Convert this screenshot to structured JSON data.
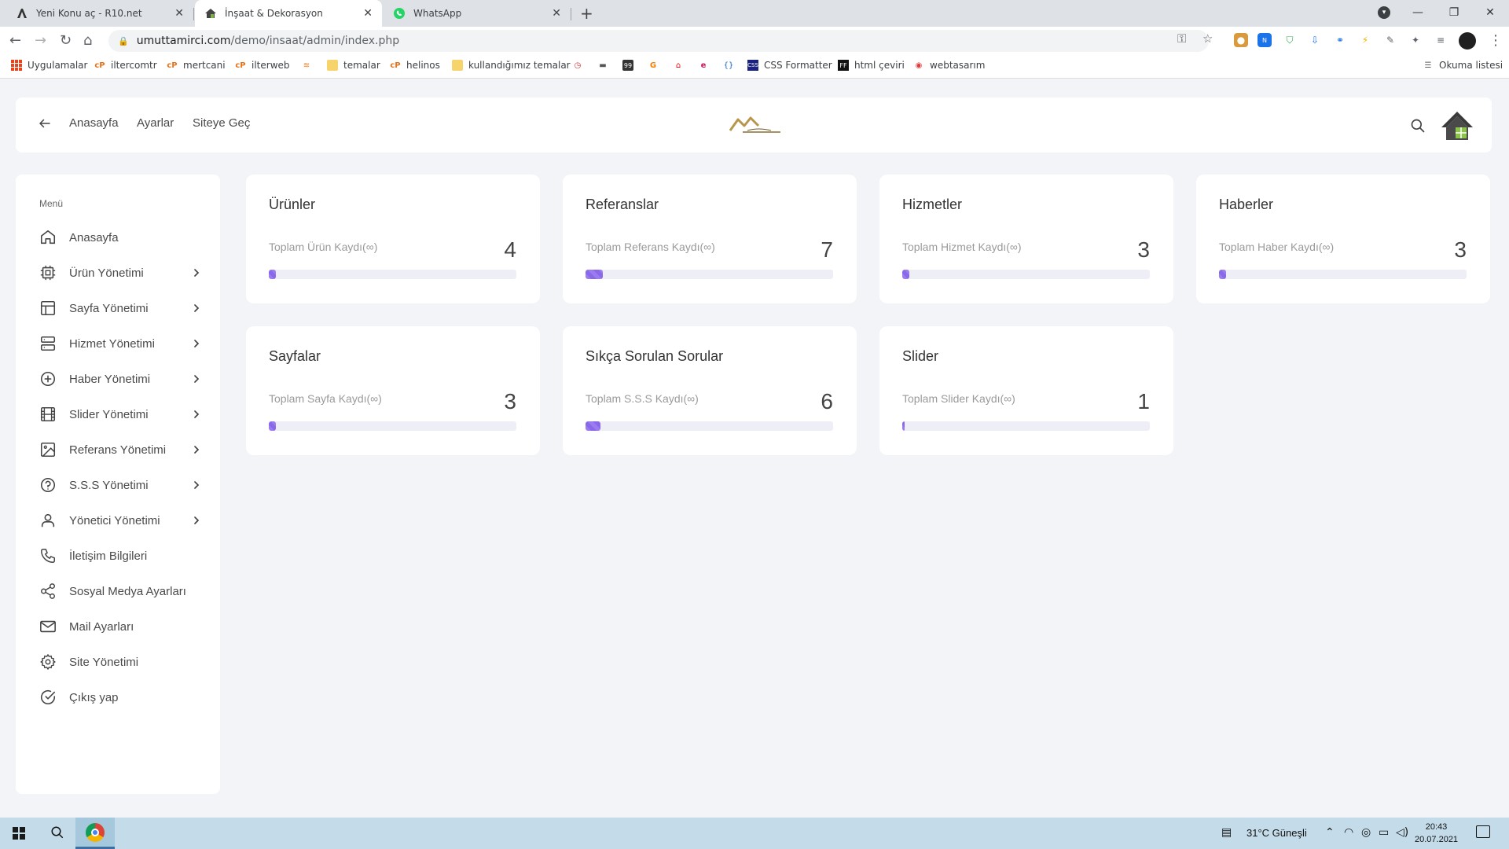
{
  "browser": {
    "tabs": [
      {
        "title": "Yeni Konu aç - R10.net",
        "icon": "r10-icon",
        "active": false
      },
      {
        "title": "İnşaat & Dekorasyon",
        "icon": "house-icon",
        "active": true
      },
      {
        "title": "WhatsApp",
        "icon": "whatsapp-icon",
        "active": false
      }
    ],
    "url_host": "umuttamirci.com",
    "url_path": "/demo/insaat/admin/index.php",
    "bookmarks": [
      {
        "label": "Uygulamalar",
        "icon": "apps-icon"
      },
      {
        "label": "iltercomtr",
        "icon": "cpanel-icon"
      },
      {
        "label": "mertcani",
        "icon": "cpanel-icon"
      },
      {
        "label": "ilterweb",
        "icon": "cpanel-icon"
      },
      {
        "label": "",
        "icon": "stackoverflow-icon"
      },
      {
        "label": "temalar",
        "icon": "folder-icon"
      },
      {
        "label": "helinos",
        "icon": "cpanel-icon"
      },
      {
        "label": "kullandığımız temalar",
        "icon": "folder-icon"
      },
      {
        "label": "",
        "icon": "timer-icon"
      },
      {
        "label": "",
        "icon": "dash-icon"
      },
      {
        "label": "",
        "icon": "99-icon"
      },
      {
        "label": "",
        "icon": "g-icon"
      },
      {
        "label": "",
        "icon": "home-red-icon"
      },
      {
        "label": "",
        "icon": "e-icon"
      },
      {
        "label": "",
        "icon": "braces-icon"
      },
      {
        "label": "CSS Formatter",
        "icon": "css-icon"
      },
      {
        "label": "html çeviri",
        "icon": "ff-icon"
      },
      {
        "label": "webtasarım",
        "icon": "web-icon"
      }
    ],
    "reading_list": "Okuma listesi"
  },
  "topnav": {
    "links": [
      "Anasayfa",
      "Ayarlar",
      "Siteye Geç"
    ]
  },
  "sidebar": {
    "title": "Menü",
    "items": [
      {
        "label": "Anasayfa",
        "icon": "home-icon",
        "has_submenu": false
      },
      {
        "label": "Ürün Yönetimi",
        "icon": "cpu-icon",
        "has_submenu": true
      },
      {
        "label": "Sayfa Yönetimi",
        "icon": "layout-icon",
        "has_submenu": true
      },
      {
        "label": "Hizmet Yönetimi",
        "icon": "server-icon",
        "has_submenu": true
      },
      {
        "label": "Haber Yönetimi",
        "icon": "plus-circle-icon",
        "has_submenu": true
      },
      {
        "label": "Slider Yönetimi",
        "icon": "film-icon",
        "has_submenu": true
      },
      {
        "label": "Referans Yönetimi",
        "icon": "image-icon",
        "has_submenu": true
      },
      {
        "label": "S.S.S Yönetimi",
        "icon": "help-circle-icon",
        "has_submenu": true
      },
      {
        "label": "Yönetici Yönetimi",
        "icon": "user-icon",
        "has_submenu": true
      },
      {
        "label": "İletişim Bilgileri",
        "icon": "phone-icon",
        "has_submenu": false
      },
      {
        "label": "Sosyal Medya Ayarları",
        "icon": "share-icon",
        "has_submenu": false
      },
      {
        "label": "Mail Ayarları",
        "icon": "mail-icon",
        "has_submenu": false
      },
      {
        "label": "Site Yönetimi",
        "icon": "settings-icon",
        "has_submenu": false
      },
      {
        "label": "Çıkış yap",
        "icon": "check-circle-icon",
        "has_submenu": false
      }
    ]
  },
  "cards": [
    {
      "title": "Ürünler",
      "subtitle": "Toplam Ürün Kaydı(∞)",
      "count": "4",
      "progress": 0.03
    },
    {
      "title": "Referanslar",
      "subtitle": "Toplam Referans Kaydı(∞)",
      "count": "7",
      "progress": 0.07
    },
    {
      "title": "Hizmetler",
      "subtitle": "Toplam Hizmet Kaydı(∞)",
      "count": "3",
      "progress": 0.03
    },
    {
      "title": "Haberler",
      "subtitle": "Toplam Haber Kaydı(∞)",
      "count": "3",
      "progress": 0.03
    },
    {
      "title": "Sayfalar",
      "subtitle": "Toplam Sayfa Kaydı(∞)",
      "count": "3",
      "progress": 0.03
    },
    {
      "title": "Sıkça Sorulan Sorular",
      "subtitle": "Toplam S.S.S Kaydı(∞)",
      "count": "6",
      "progress": 0.06
    },
    {
      "title": "Slider",
      "subtitle": "Toplam Slider Kaydı(∞)",
      "count": "1",
      "progress": 0.01
    }
  ],
  "taskbar": {
    "weather": "31°C  Güneşli",
    "time": "20:43",
    "date": "20.07.2021"
  },
  "colors": {
    "accent": "#8a68ea",
    "background": "#f3f4f8"
  }
}
